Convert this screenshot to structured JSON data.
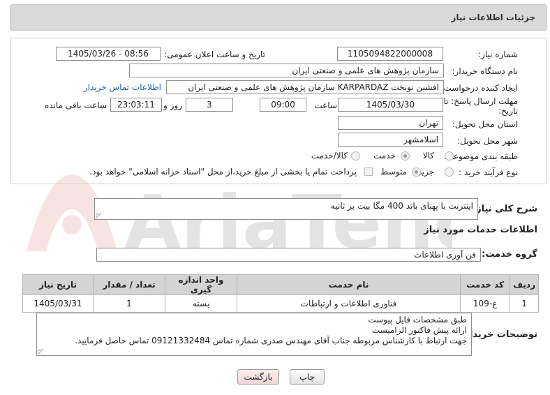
{
  "header": {
    "title": "جزئیات اطلاعات نیاز"
  },
  "form": {
    "need_number_label": "شماره نیاز:",
    "need_number": "1105094822000008",
    "announce_label": "تاریخ و ساعت اعلان عمومی:",
    "announce_value": "1405/03/26 - 08:56",
    "buyer_org_label": "نام دستگاه خریدار:",
    "buyer_org": "سازمان پژوهش های علمی و صنعتی ایران",
    "creator_label": "ایجاد کننده درخواست:",
    "creator": "افشین نوبخت KARPARDAZ سازمان پژوهش های علمی و صنعتی ایران",
    "buyer_contact_link": "اطلاعات تماس خریدار",
    "deadline_label_1": "مهلت ارسال پاسخ: تا",
    "deadline_label_2": "تاریخ:",
    "deadline_date": "1405/03/30",
    "time_label": "ساعت",
    "deadline_time": "09:00",
    "days_value": "3",
    "days_label": "روز و",
    "remaining_time": "23:03:11",
    "remaining_label": "ساعت باقی مانده",
    "province_label": "استان محل تحویل:",
    "province": "تهران",
    "city_label": "شهر محل تحویل:",
    "city": "اسلامشهر",
    "category_label": "طبقه بندی موضوعی:",
    "category_options": [
      "کالا",
      "خدمت",
      "کالا/خدمت"
    ],
    "category_selected": "خدمت",
    "process_label": "نوع فرآیند خرید :",
    "process_options": [
      "جزیی",
      "متوسط"
    ],
    "process_selected": "متوسط",
    "payment_note": "پرداخت تمام یا بخشی از مبلغ خرید،از محل \"اسناد خزانه اسلامی\" خواهد بود."
  },
  "summary": {
    "label": "شرح کلی نیاز:",
    "value": "اینترنت با پهنای باند 400 مگا بیت بر ثانیه"
  },
  "services_section": {
    "title": "اطلاعات خدمات مورد نیاز",
    "group_label": "گروه خدمت:",
    "group_value": "فن آوری اطلاعات"
  },
  "table": {
    "headers": [
      "ردیف",
      "کد خدمت",
      "نام خدمت",
      "واحد اندازه گیری",
      "تعداد / مقدار",
      "تاریخ نیاز"
    ],
    "rows": [
      [
        "1",
        "غ-109",
        "فناوری اطلاعات و ارتباطات",
        "بسته",
        "1",
        "1405/03/31"
      ]
    ]
  },
  "buyer_notes": {
    "label": "توضیحات خریدار:",
    "lines": [
      "طبق مشخصات فایل پیوست",
      "ارائه پیش فاکتور الزامیست",
      "جهت ارتباط با کارشناس مربوطه جناب آقای مهندس صدری شماره تماس 09121332484 تماس حاصل فرمایید."
    ]
  },
  "buttons": {
    "print": "چاپ",
    "back": "بازگشت"
  },
  "colors": {
    "header_bg": "#d9d9d9",
    "table_header_bg": "#d4d4d4",
    "link": "#1a5fb4",
    "back_button_bg": "#f9dede"
  }
}
